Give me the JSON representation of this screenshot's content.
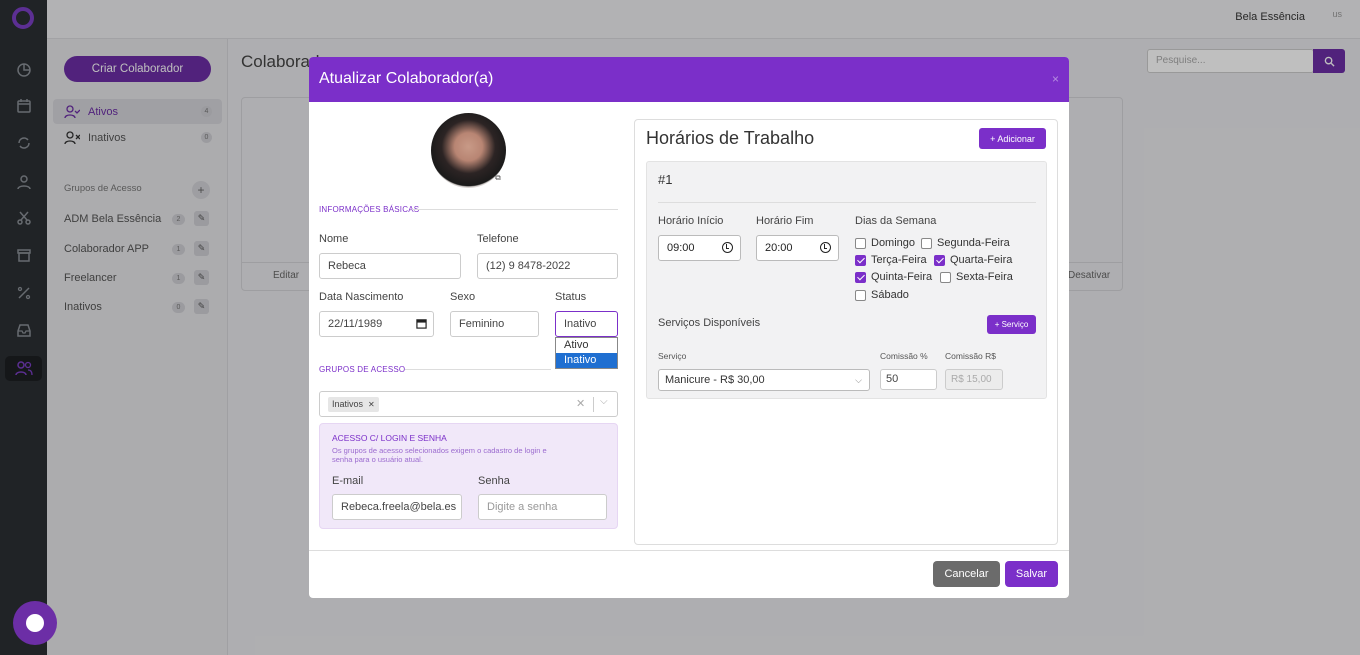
{
  "topbar": {
    "company": "Bela Essência",
    "avatar_alt": "us"
  },
  "left_panel": {
    "create_button": "Criar Colaborador",
    "nav": [
      {
        "label": "Ativos",
        "count": "4"
      },
      {
        "label": "Inativos",
        "count": "0"
      }
    ],
    "groups_title": "Grupos de Acesso",
    "groups": [
      {
        "label": "ADM Bela Essência",
        "count": "2"
      },
      {
        "label": "Colaborador APP",
        "count": "1"
      },
      {
        "label": "Freelancer",
        "count": "1"
      },
      {
        "label": "Inativos",
        "count": "0"
      }
    ]
  },
  "main": {
    "title": "Colaboradores",
    "search_placeholder": "Pesquise...",
    "card_edit": "Editar",
    "card_deactivate": "Desativar"
  },
  "modal": {
    "title": "Atualizar Colaborador(a)",
    "close": "×",
    "basic_info_section": "INFORMAÇÕES BÁSICAS",
    "fields": {
      "name_label": "Nome",
      "name_value": "Rebeca",
      "phone_label": "Telefone",
      "phone_value": "(12) 9 8478-2022",
      "birth_label": "Data Nascimento",
      "birth_value": "22/11/1989",
      "sex_label": "Sexo",
      "sex_value": "Feminino",
      "status_label": "Status",
      "status_value": "Inativo",
      "status_options": [
        "Ativo",
        "Inativo"
      ]
    },
    "access_section": "GRUPOS DE ACESSO",
    "access_tag": "Inativos",
    "login_box": {
      "title": "ACESSO C/ LOGIN E SENHA",
      "desc": "Os grupos de acesso selecionados exigem o cadastro de login e senha para o usuário atual.",
      "email_label": "E-mail",
      "email_value": "Rebeca.freela@bela.es",
      "password_label": "Senha",
      "password_placeholder": "Digite a senha"
    },
    "schedule": {
      "title": "Horários de Trabalho",
      "add_button": "+ Adicionar",
      "entry_number": "#1",
      "start_label": "Horário Início",
      "start_value": "09:00",
      "end_label": "Horário Fim",
      "end_value": "20:00",
      "days_label": "Dias da Semana",
      "days": [
        {
          "label": "Domingo",
          "checked": false
        },
        {
          "label": "Segunda-Feira",
          "checked": false
        },
        {
          "label": "Terça-Feira",
          "checked": true
        },
        {
          "label": "Quarta-Feira",
          "checked": true
        },
        {
          "label": "Quinta-Feira",
          "checked": true
        },
        {
          "label": "Sexta-Feira",
          "checked": false
        },
        {
          "label": "Sábado",
          "checked": false
        }
      ],
      "services_label": "Serviços Disponíveis",
      "add_service_button": "+ Serviço",
      "service_col": "Serviço",
      "commission_pct_col": "Comissão %",
      "commission_val_col": "Comissão R$",
      "service_value": "Manicure - R$ 30,00",
      "commission_pct_value": "50",
      "commission_val_value": "R$ 15,00"
    },
    "cancel_button": "Cancelar",
    "save_button": "Salvar"
  },
  "colors": {
    "accent": "#7b2fc9",
    "sidebar": "#2b2f33"
  }
}
